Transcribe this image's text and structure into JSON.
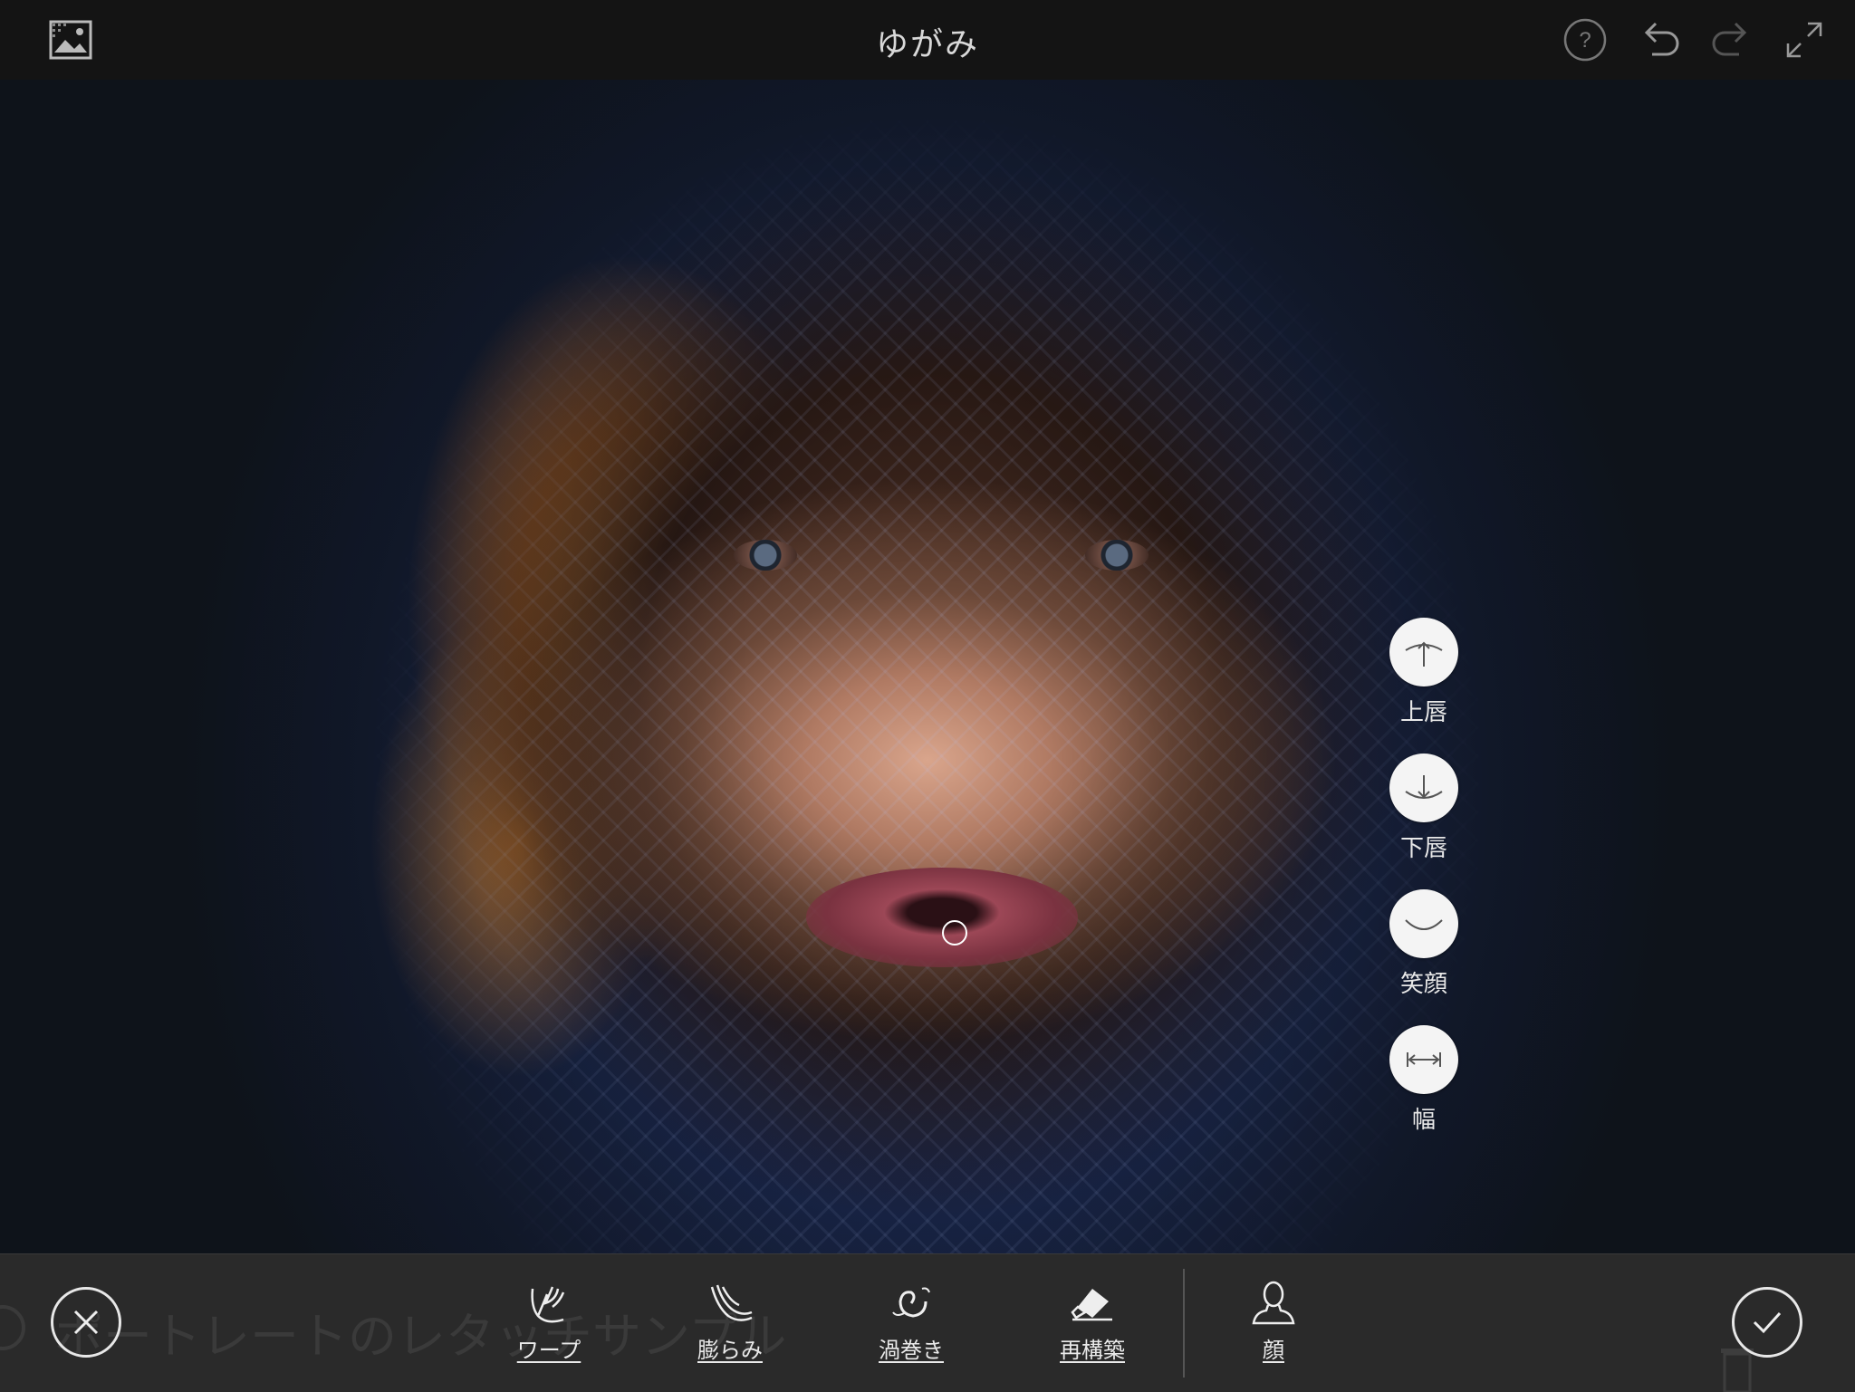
{
  "header": {
    "title": "ゆがみ",
    "icons": [
      "image-icon",
      "help-icon",
      "undo-icon",
      "redo-icon",
      "fullscreen-icon"
    ]
  },
  "lip_tools": [
    {
      "name": "upper-lip",
      "icon": "arrow-up-curve-icon",
      "label": "上唇"
    },
    {
      "name": "lower-lip",
      "icon": "arrow-down-curve-icon",
      "label": "下唇"
    },
    {
      "name": "smile",
      "icon": "smile-curve-icon",
      "label": "笑顔"
    },
    {
      "name": "width",
      "icon": "width-arrows-icon",
      "label": "幅"
    }
  ],
  "toolbar": {
    "background_text": "ポートレートのレタッチサンプル",
    "cancel_icon": "close-icon",
    "confirm_icon": "check-icon",
    "tools": [
      {
        "name": "warp",
        "icon": "warp-hand-icon",
        "label": "ワープ"
      },
      {
        "name": "bloat",
        "icon": "bloat-hand-icon",
        "label": "膨らみ"
      },
      {
        "name": "swirl",
        "icon": "swirl-icon",
        "label": "渦巻き"
      },
      {
        "name": "reconstruct",
        "icon": "eraser-icon",
        "label": "再構築"
      },
      {
        "name": "face",
        "icon": "person-icon",
        "label": "顔"
      }
    ]
  }
}
